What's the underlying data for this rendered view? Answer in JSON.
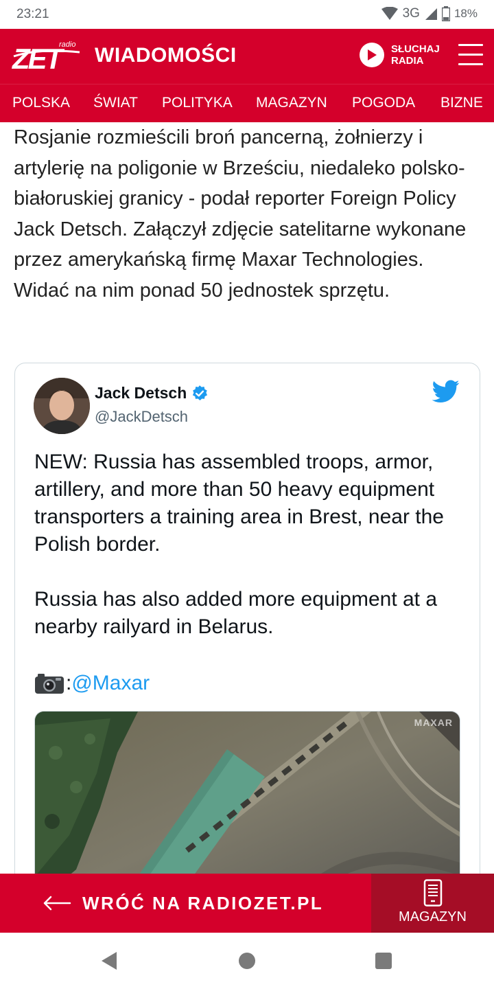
{
  "status_bar": {
    "time": "23:21",
    "network": "3G",
    "battery": "18%"
  },
  "header": {
    "logo_text": "ZET",
    "logo_sub": "radio",
    "title": "WIADOMOŚCI",
    "listen_label": "SŁUCHAJ RADIA"
  },
  "nav": {
    "items": [
      "POLSKA",
      "ŚWIAT",
      "POLITYKA",
      "MAGAZYN",
      "POGODA",
      "BIZNE"
    ]
  },
  "article": {
    "paragraph": "Rosjanie rozmieścili broń pancerną, żołnierzy i artylerię na poligonie w Brześciu, niedaleko polsko-białoruskiej granicy - podał reporter Foreign Policy Jack Detsch. Załączył zdjęcie satelitarne wykonane przez amerykańską firmę Maxar Technologies. Widać na nim ponad 50 jednostek sprzętu."
  },
  "tweet": {
    "author_name": "Jack Detsch",
    "handle": "@JackDetsch",
    "text": "NEW: Russia has assembled troops, armor, artillery, and more than 50 heavy equipment transporters a training area in Brest, near the Polish border.\n\nRussia has also added more equipment at a nearby railyard in Belarus.",
    "camera_separator": ":",
    "mention": "@Maxar",
    "image_watermark": "MAXAR"
  },
  "bottom_banner": {
    "back_label": "WRÓĆ NA RADIOZET.PL",
    "magazyn_label": "MAGAZYN"
  },
  "colors": {
    "brand_red": "#d4002b",
    "brand_dark_red": "#a50d26",
    "twitter_blue": "#1d9bf0"
  },
  "icons": [
    "play-icon",
    "hamburger-menu-icon",
    "verified-badge-icon",
    "twitter-bird-icon",
    "camera-icon",
    "arrow-left-icon",
    "tablet-icon",
    "android-back-icon",
    "android-home-icon",
    "android-recents-icon"
  ]
}
